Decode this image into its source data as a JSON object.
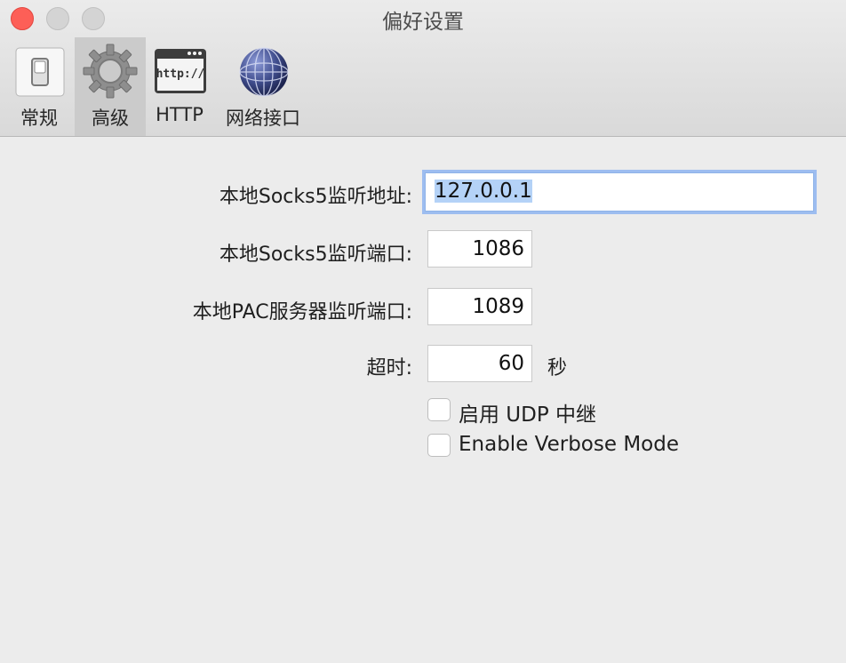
{
  "window": {
    "title": "偏好设置"
  },
  "toolbar": {
    "items": [
      {
        "label": "常规",
        "icon": "switch-icon"
      },
      {
        "label": "高级",
        "icon": "gear-icon"
      },
      {
        "label": "HTTP",
        "icon": "http-icon"
      },
      {
        "label": "网络接口",
        "icon": "network-globe-icon"
      }
    ],
    "selected": "高级"
  },
  "form": {
    "socks_address": {
      "label": "本地Socks5监听地址:",
      "value": "127.0.0.1"
    },
    "socks_port": {
      "label": "本地Socks5监听端口:",
      "value": "1086"
    },
    "pac_port": {
      "label": "本地PAC服务器监听端口:",
      "value": "1089"
    },
    "timeout": {
      "label": "超时:",
      "value": "60",
      "unit": "秒"
    },
    "udp_relay": {
      "label": "启用 UDP 中继",
      "checked": false
    },
    "verbose": {
      "label": "Enable Verbose Mode",
      "checked": false
    }
  },
  "colors": {
    "accent": "#9dbdf0",
    "close": "#fd5f57"
  }
}
